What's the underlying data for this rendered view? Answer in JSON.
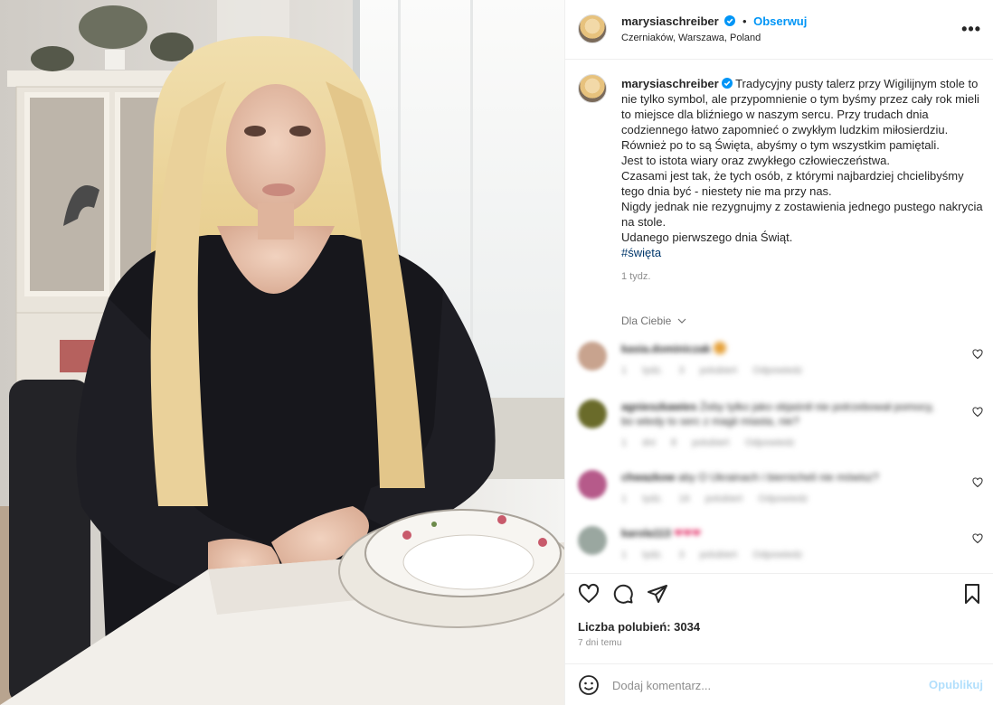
{
  "header": {
    "username": "marysiaschreiber",
    "separator": "•",
    "follow_label": "Obserwuj",
    "location": "Czerniaków, Warszawa, Poland",
    "more_icon": "more-horizontal-icon"
  },
  "caption": {
    "username": "marysiaschreiber",
    "text": "Tradycyjny pusty talerz przy Wigilijnym stole to nie tylko symbol, ale przypomnienie o tym byśmy przez cały rok mieli to miejsce dla bliźniego w naszym sercu. Przy trudach dnia codziennego łatwo zapomnieć o zwykłym ludzkim miłosierdziu. Również po to są Święta, abyśmy o tym wszystkim pamiętali.\nJest to istota wiary oraz zwykłego człowieczeństwa.\nCzasami jest tak, że tych osób, z którymi najbardziej chcielibyśmy tego dnia być - niestety nie ma przy nas.\nNigdy jednak nie rezygnujmy z zostawienia jednego pustego nakrycia na stole.\nUdanego pierwszego dnia Świąt.",
    "hashtag": "#święta",
    "time": "1 tydz."
  },
  "for_you": "Dla Ciebie",
  "comments": [
    {
      "username": "kasia.dominiczak",
      "text": "",
      "meta": "1 tydz. 3 polubień Odpowiedz"
    },
    {
      "username": "agnieszkawies",
      "text": "Żeby tylko jako objaśnił nie potrzebował pomocy, bo wtedy to serc z magii miasta, nie?",
      "meta": "1 dni 8 polubień Odpowiedz"
    },
    {
      "username": "chwazkow",
      "text": "aby O Ukrainach i biernicheli nie mówisz?",
      "meta": "1 tydz. 16 polubień Odpowiedz"
    },
    {
      "username": "karola113",
      "text": "❤❤❤",
      "meta": "1 tydz. 3 polubień Odpowiedz"
    }
  ],
  "likes": "Liczba polubień: 3034",
  "date": "7 dni temu",
  "add_comment": {
    "placeholder": "Dodaj komentarz...",
    "publish_label": "Opublikuj"
  },
  "colors": {
    "accent": "#0095f6",
    "hashtag": "#00376b",
    "muted": "#8e8e8e",
    "publish_disabled": "#b2dffc"
  }
}
